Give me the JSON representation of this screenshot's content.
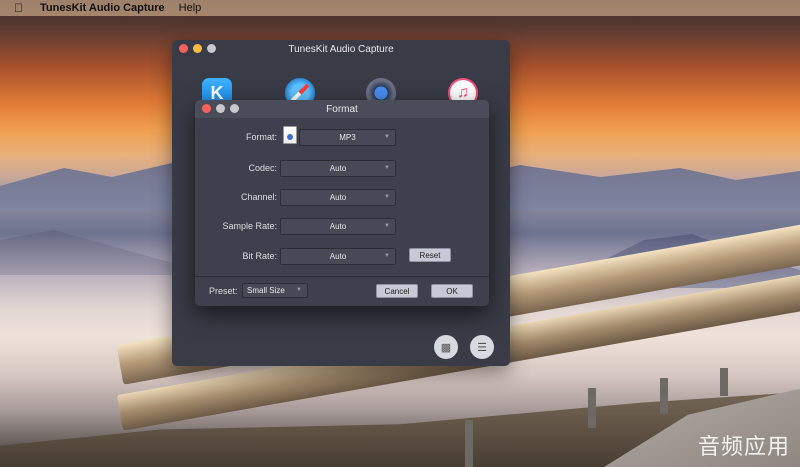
{
  "menubar": {
    "app_name": "TunesKit Audio Capture",
    "help": "Help"
  },
  "main_window": {
    "title": "TunesKit Audio Capture"
  },
  "format_dialog": {
    "title": "Format",
    "format": {
      "label": "Format:",
      "value": "MP3"
    },
    "codec": {
      "label": "Codec:",
      "value": "Auto"
    },
    "channel": {
      "label": "Channel:",
      "value": "Auto"
    },
    "sample_rate": {
      "label": "Sample Rate:",
      "value": "Auto"
    },
    "bit_rate": {
      "label": "Bit Rate:",
      "value": "Auto"
    },
    "reset_label": "Reset",
    "preset": {
      "label": "Preset:",
      "value": "Small Size"
    },
    "cancel_label": "Cancel",
    "ok_label": "OK"
  },
  "watermark": "音频应用"
}
